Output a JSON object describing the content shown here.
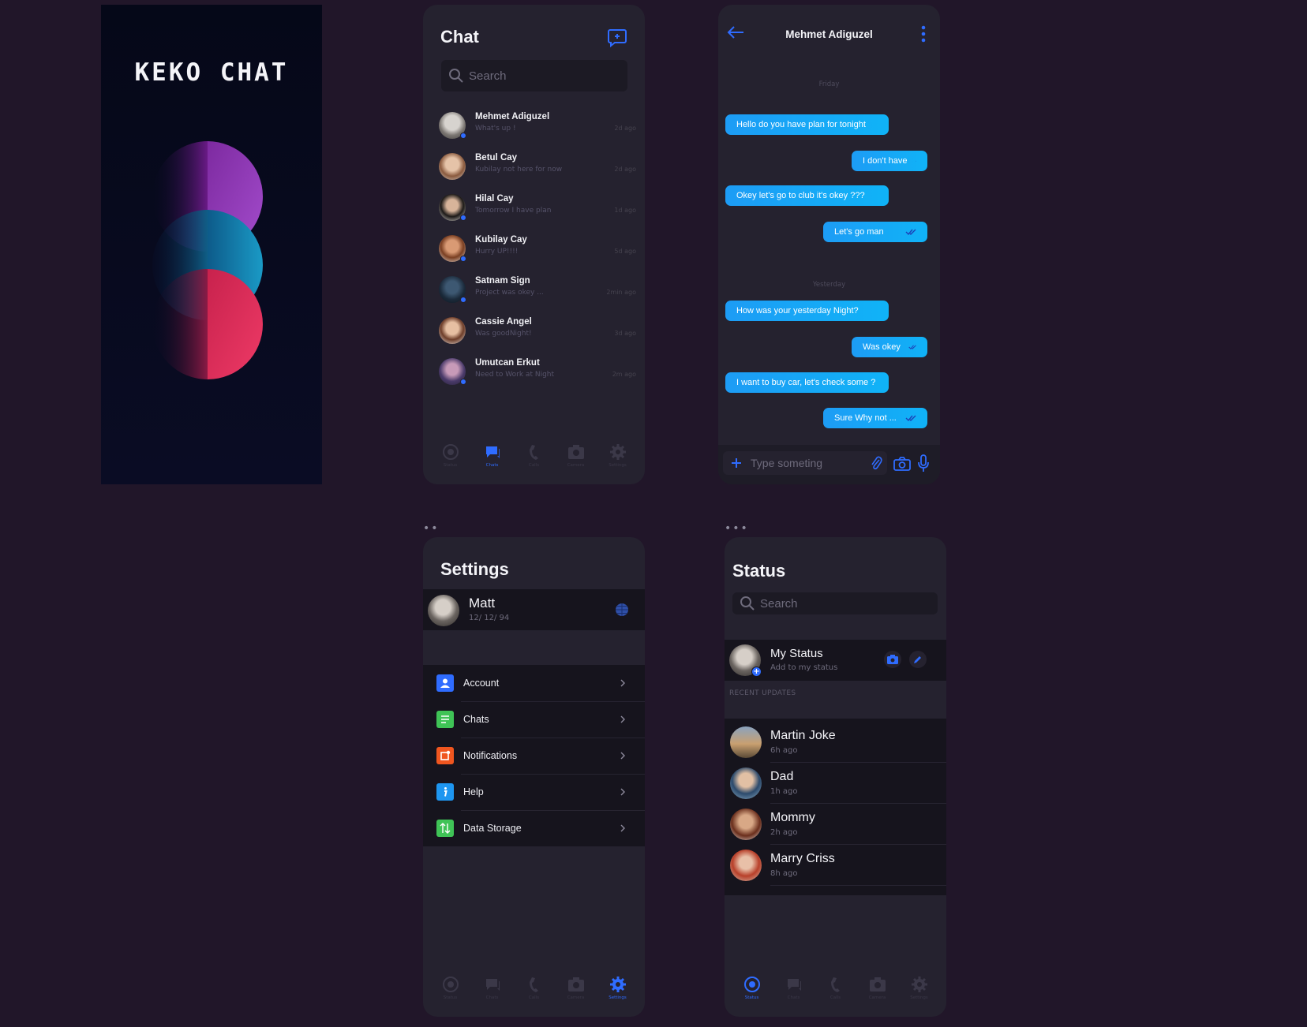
{
  "splash": {
    "logo": "KEKO CHAT"
  },
  "markers": {
    "settings": "••",
    "status": "•••"
  },
  "chat_list": {
    "title": "Chat",
    "search_placeholder": "Search",
    "chats": [
      {
        "name": "Mehmet Adiguzel",
        "preview": "What's up !",
        "time": "2d ago"
      },
      {
        "name": "Betul Cay",
        "preview": "Kubilay not here for now",
        "time": "2d ago"
      },
      {
        "name": "Hilal Cay",
        "preview": "Tomorrow I have plan",
        "time": "1d ago"
      },
      {
        "name": "Kubilay Cay",
        "preview": "Hurry UP!!!!",
        "time": "5d ago"
      },
      {
        "name": "Satnam Sign",
        "preview": "Project was okey ...",
        "time": "2min ago"
      },
      {
        "name": "Cassie Angel",
        "preview": "Was goodNight!",
        "time": "3d ago"
      },
      {
        "name": "Umutcan Erkut",
        "preview": "Need to Work at Night",
        "time": "2m ago"
      }
    ],
    "nav": [
      "Status",
      "Chats",
      "Calls",
      "Camera",
      "Settings"
    ]
  },
  "conversation": {
    "title": "Mehmet Adiguzel",
    "day1": "Friday",
    "day2": "Yesterday",
    "messages": [
      {
        "text": "Hello do you have plan for tonight",
        "dir": "in"
      },
      {
        "text": "I don't have",
        "dir": "out"
      },
      {
        "text": "Okey let's go to club it's okey ???",
        "dir": "in"
      },
      {
        "text": "Let's go man",
        "dir": "out"
      },
      {
        "text": "How was your yesterday Night?",
        "dir": "in"
      },
      {
        "text": "Was okey",
        "dir": "out"
      },
      {
        "text": "I want to buy car, let's check some ?",
        "dir": "in"
      },
      {
        "text": "Sure Why not ...",
        "dir": "out"
      }
    ],
    "composer_placeholder": "Type someting"
  },
  "settings": {
    "title": "Settings",
    "profile": {
      "name": "Matt",
      "date": "12/ 12/ 94"
    },
    "items": [
      {
        "label": "Account",
        "icon": "account-icon",
        "color": "#2f6cff"
      },
      {
        "label": "Chats",
        "icon": "chats-icon",
        "color": "#3fc356"
      },
      {
        "label": "Notifications",
        "icon": "notifications-icon",
        "color": "#f0561f"
      },
      {
        "label": "Help",
        "icon": "help-icon",
        "color": "#1e96f0"
      },
      {
        "label": "Data Storage",
        "icon": "data-storage-icon",
        "color": "#3fc356"
      }
    ]
  },
  "status": {
    "title": "Status",
    "search_placeholder": "Search",
    "my_status": {
      "title": "My Status",
      "subtitle": "Add to my status"
    },
    "recent_header": "RECENT UPDATES",
    "updates": [
      {
        "name": "Martin Joke",
        "time": "6h ago"
      },
      {
        "name": "Dad",
        "time": "1h ago"
      },
      {
        "name": "Mommy",
        "time": "2h ago"
      },
      {
        "name": "Marry Criss",
        "time": "8h ago"
      }
    ]
  },
  "colors": {
    "accent": "#2f6cff",
    "bubble": "#17a8f6",
    "background": "#211629",
    "panel": "#25222f"
  }
}
